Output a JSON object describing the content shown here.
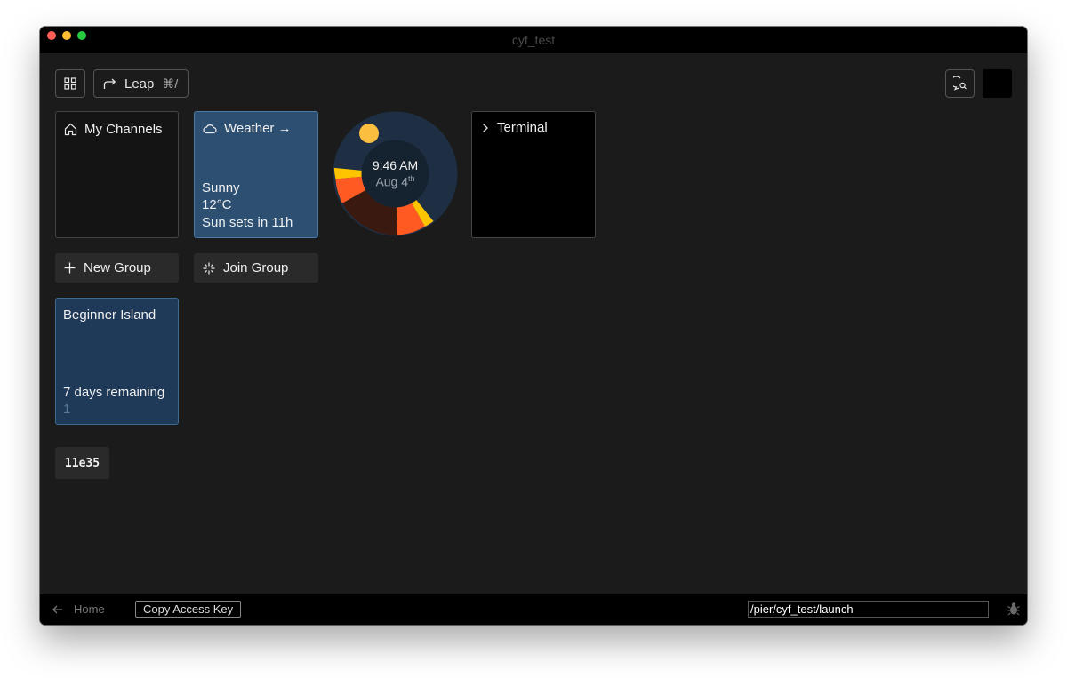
{
  "window": {
    "title": "cyf_test"
  },
  "toolbar": {
    "leap_label": "Leap",
    "leap_shortcut": "⌘/"
  },
  "tiles": {
    "channels": {
      "label": "My Channels"
    },
    "weather": {
      "label": "Weather →",
      "condition": "Sunny",
      "temperature": "12°C",
      "sunset": "Sun sets in 11h"
    },
    "clock": {
      "time": "9:46 AM",
      "date": "Aug 4",
      "date_suffix": "th"
    },
    "terminal": {
      "label": "Terminal"
    }
  },
  "groups": {
    "new_label": "New Group",
    "join_label": "Join Group"
  },
  "island": {
    "title": "Beginner Island",
    "remaining": "7 days remaining",
    "count": "1"
  },
  "hash_label": "11e35",
  "footer": {
    "home_label": "Home",
    "copy_label": "Copy Access Key",
    "path_value": "/pier/cyf_test/launch"
  },
  "colors": {
    "window_bg": "#1b1b1b",
    "weather_tile": "#2c4f72",
    "island_tile": "#1f3958",
    "clock_ring": "#1e2f44",
    "sun": "#fbbf3f",
    "sunset_orange": "#ff5a22",
    "sunset_yellow": "#ffc400",
    "night": "#3a1a10"
  }
}
